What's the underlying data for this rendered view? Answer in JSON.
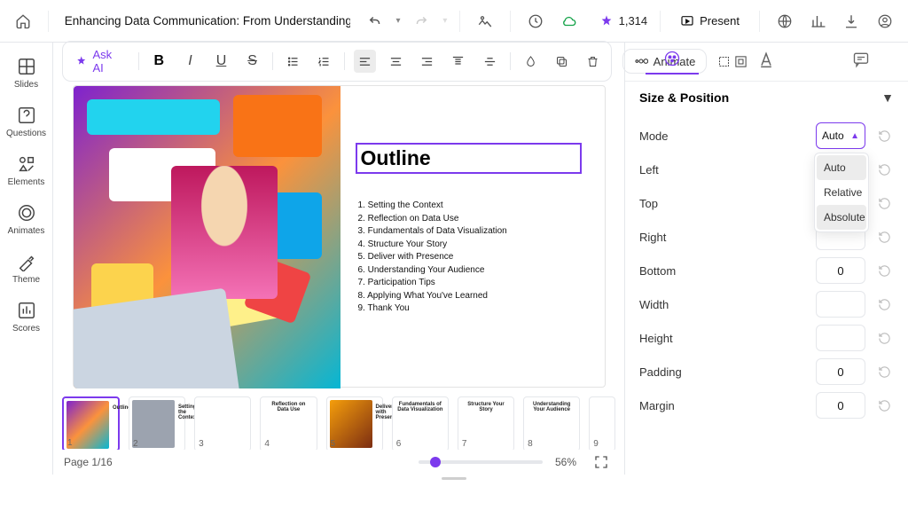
{
  "doc_title": "Enhancing Data Communication: From Understanding to Enga",
  "credits": "1,314",
  "present_label": "Present",
  "leftnav": [
    {
      "label": "Slides"
    },
    {
      "label": "Questions"
    },
    {
      "label": "Elements"
    },
    {
      "label": "Animates"
    },
    {
      "label": "Theme"
    },
    {
      "label": "Scores"
    }
  ],
  "ask_ai_label": "Ask AI",
  "animate_label": "Animate",
  "slide": {
    "heading": "Outline",
    "items": [
      "1. Setting the Context",
      "2. Reflection on Data Use",
      "3. Fundamentals of Data Visualization",
      "4. Structure Your Story",
      "5. Deliver with Presence",
      "6. Understanding Your Audience",
      "7. Participation Tips",
      "8. Applying What You've Learned",
      "9. Thank You"
    ]
  },
  "thumbnails": [
    {
      "num": "1",
      "title": "Outline"
    },
    {
      "num": "2",
      "title": "Setting the Context"
    },
    {
      "num": "3",
      "title": ""
    },
    {
      "num": "4",
      "title": "Reflection on Data Use"
    },
    {
      "num": "5",
      "title": "Deliver with Presence"
    },
    {
      "num": "6",
      "title": "Fundamentals of Data Visualization"
    },
    {
      "num": "7",
      "title": "Structure Your Story"
    },
    {
      "num": "8",
      "title": "Understanding Your Audience"
    },
    {
      "num": "9",
      "title": ""
    }
  ],
  "page_indicator": "Page 1/16",
  "zoom_label": "56%",
  "right_panel": {
    "section_title": "Size & Position",
    "mode": {
      "label": "Mode",
      "value": "Auto",
      "options": [
        "Auto",
        "Relative",
        "Absolute"
      ]
    },
    "props": [
      {
        "label": "Left",
        "value": ""
      },
      {
        "label": "Top",
        "value": ""
      },
      {
        "label": "Right",
        "value": ""
      },
      {
        "label": "Bottom",
        "value": "0"
      },
      {
        "label": "Width",
        "value": ""
      },
      {
        "label": "Height",
        "value": ""
      },
      {
        "label": "Padding",
        "value": "0"
      },
      {
        "label": "Margin",
        "value": "0"
      }
    ]
  }
}
